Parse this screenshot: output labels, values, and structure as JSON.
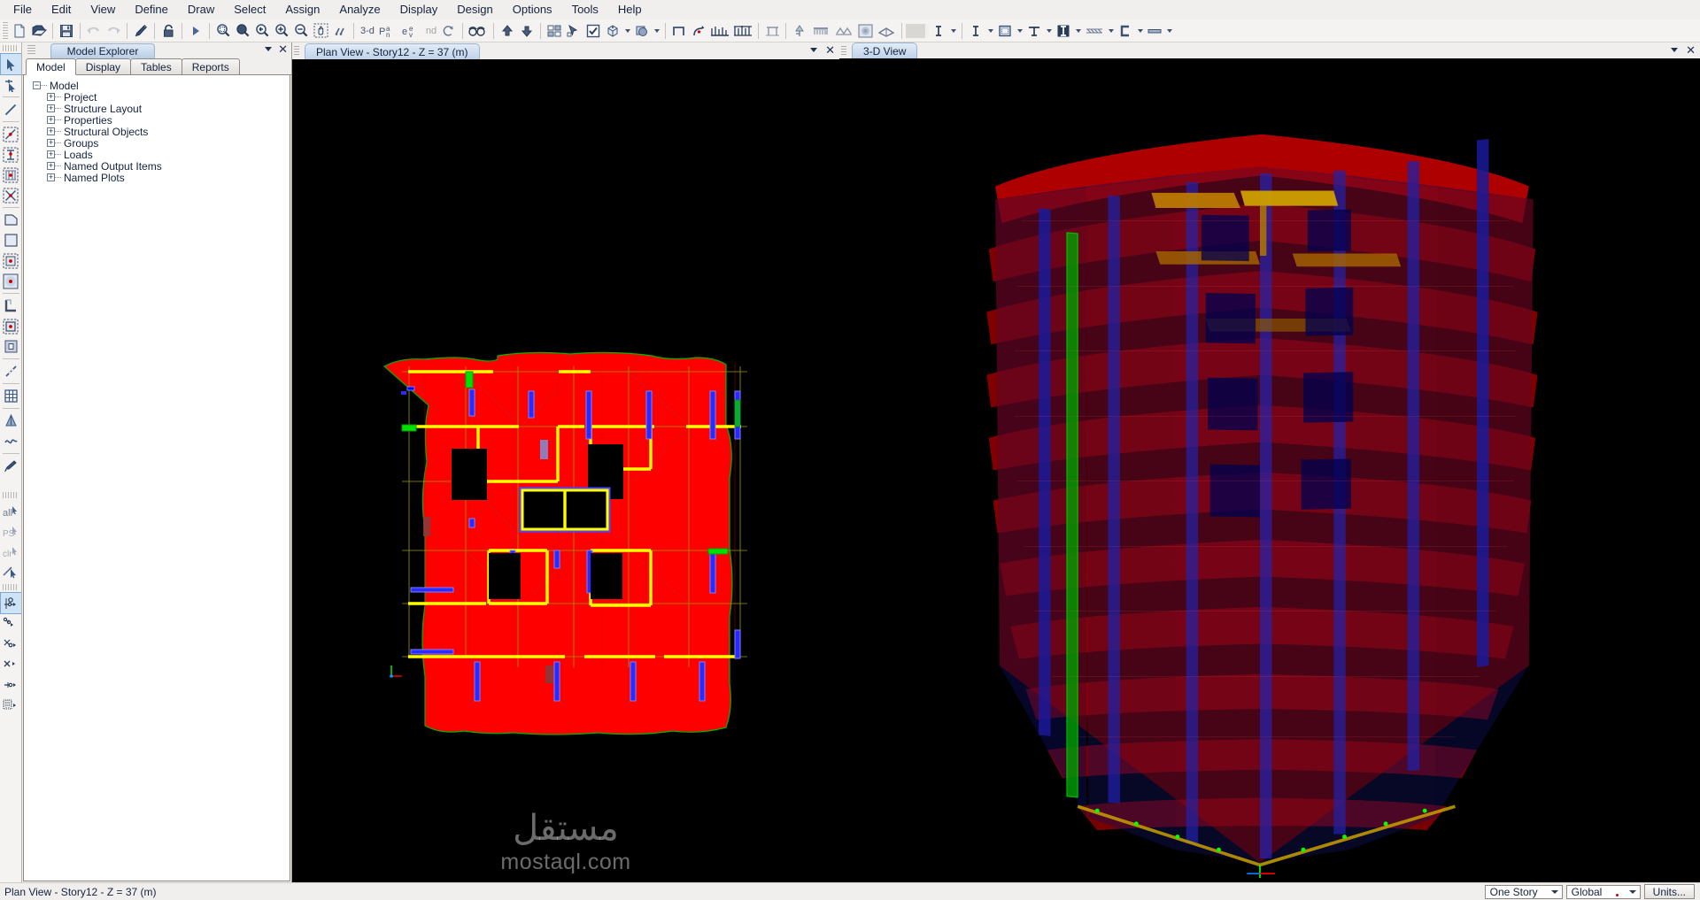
{
  "menu": {
    "items": [
      "File",
      "Edit",
      "View",
      "Define",
      "Draw",
      "Select",
      "Assign",
      "Analyze",
      "Display",
      "Design",
      "Options",
      "Tools",
      "Help"
    ]
  },
  "toolbar": {
    "labels": {
      "three_d": "3-d",
      "plan": "pln",
      "elev": "elev",
      "nd": "nd"
    },
    "icons": [
      "new-model-icon",
      "open-model-icon",
      "save-model-icon",
      "undo-icon",
      "redo-icon",
      "edit-icon",
      "lock-model-icon",
      "run-analysis-icon",
      "rubber-band-zoom-icon",
      "zoom-in-one-step-icon",
      "zoom-out-one-step-icon",
      "zoom-previous-icon",
      "zoom-full-icon",
      "pan-icon",
      "restore-full-view-icon",
      "3d-view-icon",
      "plan-view-icon",
      "elevation-view-icon",
      "named-view-icon",
      "refresh-window-icon",
      "perspective-toggle-icon",
      "move-up-story-icon",
      "move-down-story-icon",
      "object-snap-icon",
      "select-pointer-icon",
      "set-display-options-icon",
      "set-3d-view-icon",
      "object-fill-icon",
      "show-undeformed-shape-icon",
      "deformed-shape-icon",
      "show-forces-diagram-icon",
      "shear-diagram-icon",
      "frame-section-cut-icon",
      "joint-response-icon",
      "assign-loads-icon",
      "support-reactions-icon",
      "contour-plot-icon",
      "section-cut-icon",
      "text-label-icon",
      "column-section-icon",
      "beam-section-icon",
      "brace-section-icon",
      "wall-section-icon",
      "slab-section-icon",
      "deck-section-icon"
    ]
  },
  "vertical_toolbar": {
    "icons": [
      "select-arrow-icon",
      "select-by-intersecting-line-icon",
      "draw-line-icon",
      "draw-beam-in-region-icon",
      "draw-column-icon",
      "draw-floor-icon",
      "draw-brace-icon",
      "draw-quad-area-icon",
      "draw-rect-area-icon",
      "draw-point-objects-icon",
      "draw-circle-area-icon",
      "draw-wall-stack-icon",
      "draw-rect-object-icon",
      "draw-secondary-beams-icon",
      "draw-dimension-line-icon",
      "quick-draw-grid-icon",
      "quick-draw-braces-icon",
      "quick-draw-secondary-beams-icon",
      "draw-reference-line-icon",
      "select-all-icon",
      "select-previous-icon",
      "clear-selection-icon",
      "select-intersecting-icon",
      "snap-to-point-icon",
      "snap-to-line-ends-icon",
      "snap-to-midpoint-icon",
      "snap-to-intersection-icon",
      "snap-to-perpendicular-icon",
      "snap-to-grid-icon"
    ],
    "text_icons": [
      "all",
      "PS",
      "clr"
    ],
    "selected_index": 0
  },
  "explorer": {
    "title": "Model Explorer",
    "tabs": [
      {
        "label": "Model",
        "active": true
      },
      {
        "label": "Display",
        "active": false
      },
      {
        "label": "Tables",
        "active": false
      },
      {
        "label": "Reports",
        "active": false
      }
    ],
    "tree": [
      {
        "label": "Model",
        "depth": 0,
        "expander": "minus"
      },
      {
        "label": "Project",
        "depth": 1,
        "expander": "plus"
      },
      {
        "label": "Structure Layout",
        "depth": 1,
        "expander": "plus"
      },
      {
        "label": "Properties",
        "depth": 1,
        "expander": "plus"
      },
      {
        "label": "Structural Objects",
        "depth": 1,
        "expander": "plus"
      },
      {
        "label": "Groups",
        "depth": 1,
        "expander": "plus"
      },
      {
        "label": "Loads",
        "depth": 1,
        "expander": "plus"
      },
      {
        "label": "Named Output Items",
        "depth": 1,
        "expander": "plus"
      },
      {
        "label": "Named Plots",
        "depth": 1,
        "expander": "plus"
      }
    ]
  },
  "views": {
    "plan": {
      "title": "Plan View - Story12 - Z = 37 (m)",
      "background": "#000000",
      "colors": {
        "slab": "#ff0000",
        "beam": "#ffff00",
        "column": "#0000ff",
        "wall": "#00cc00",
        "grid": "#999900",
        "opening": "#000000"
      }
    },
    "three_d": {
      "title": "3-D View",
      "background": "#000000",
      "colors": {
        "slab": "#a00000",
        "column": "#1414a0",
        "beam": "#b07000",
        "highlight": "#00a000"
      }
    }
  },
  "watermark": {
    "arabic": "مستقل",
    "latin": "mostaql.com"
  },
  "statusbar": {
    "message": "Plan View - Story12 - Z = 37 (m)",
    "story_select": {
      "value": "One Story"
    },
    "coord_select": {
      "value": "Global"
    },
    "units_button": "Units..."
  }
}
